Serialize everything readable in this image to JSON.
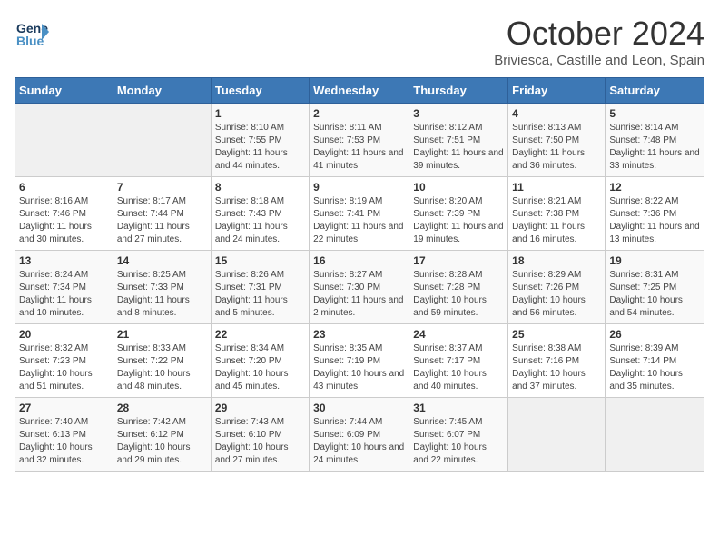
{
  "logo": {
    "general": "General",
    "blue": "Blue",
    "bird_icon": "▶"
  },
  "header": {
    "month": "October 2024",
    "location": "Briviesca, Castille and Leon, Spain"
  },
  "days_of_week": [
    "Sunday",
    "Monday",
    "Tuesday",
    "Wednesday",
    "Thursday",
    "Friday",
    "Saturday"
  ],
  "weeks": [
    [
      {
        "day": "",
        "info": ""
      },
      {
        "day": "",
        "info": ""
      },
      {
        "day": "1",
        "info": "Sunrise: 8:10 AM\nSunset: 7:55 PM\nDaylight: 11 hours and 44 minutes."
      },
      {
        "day": "2",
        "info": "Sunrise: 8:11 AM\nSunset: 7:53 PM\nDaylight: 11 hours and 41 minutes."
      },
      {
        "day": "3",
        "info": "Sunrise: 8:12 AM\nSunset: 7:51 PM\nDaylight: 11 hours and 39 minutes."
      },
      {
        "day": "4",
        "info": "Sunrise: 8:13 AM\nSunset: 7:50 PM\nDaylight: 11 hours and 36 minutes."
      },
      {
        "day": "5",
        "info": "Sunrise: 8:14 AM\nSunset: 7:48 PM\nDaylight: 11 hours and 33 minutes."
      }
    ],
    [
      {
        "day": "6",
        "info": "Sunrise: 8:16 AM\nSunset: 7:46 PM\nDaylight: 11 hours and 30 minutes."
      },
      {
        "day": "7",
        "info": "Sunrise: 8:17 AM\nSunset: 7:44 PM\nDaylight: 11 hours and 27 minutes."
      },
      {
        "day": "8",
        "info": "Sunrise: 8:18 AM\nSunset: 7:43 PM\nDaylight: 11 hours and 24 minutes."
      },
      {
        "day": "9",
        "info": "Sunrise: 8:19 AM\nSunset: 7:41 PM\nDaylight: 11 hours and 22 minutes."
      },
      {
        "day": "10",
        "info": "Sunrise: 8:20 AM\nSunset: 7:39 PM\nDaylight: 11 hours and 19 minutes."
      },
      {
        "day": "11",
        "info": "Sunrise: 8:21 AM\nSunset: 7:38 PM\nDaylight: 11 hours and 16 minutes."
      },
      {
        "day": "12",
        "info": "Sunrise: 8:22 AM\nSunset: 7:36 PM\nDaylight: 11 hours and 13 minutes."
      }
    ],
    [
      {
        "day": "13",
        "info": "Sunrise: 8:24 AM\nSunset: 7:34 PM\nDaylight: 11 hours and 10 minutes."
      },
      {
        "day": "14",
        "info": "Sunrise: 8:25 AM\nSunset: 7:33 PM\nDaylight: 11 hours and 8 minutes."
      },
      {
        "day": "15",
        "info": "Sunrise: 8:26 AM\nSunset: 7:31 PM\nDaylight: 11 hours and 5 minutes."
      },
      {
        "day": "16",
        "info": "Sunrise: 8:27 AM\nSunset: 7:30 PM\nDaylight: 11 hours and 2 minutes."
      },
      {
        "day": "17",
        "info": "Sunrise: 8:28 AM\nSunset: 7:28 PM\nDaylight: 10 hours and 59 minutes."
      },
      {
        "day": "18",
        "info": "Sunrise: 8:29 AM\nSunset: 7:26 PM\nDaylight: 10 hours and 56 minutes."
      },
      {
        "day": "19",
        "info": "Sunrise: 8:31 AM\nSunset: 7:25 PM\nDaylight: 10 hours and 54 minutes."
      }
    ],
    [
      {
        "day": "20",
        "info": "Sunrise: 8:32 AM\nSunset: 7:23 PM\nDaylight: 10 hours and 51 minutes."
      },
      {
        "day": "21",
        "info": "Sunrise: 8:33 AM\nSunset: 7:22 PM\nDaylight: 10 hours and 48 minutes."
      },
      {
        "day": "22",
        "info": "Sunrise: 8:34 AM\nSunset: 7:20 PM\nDaylight: 10 hours and 45 minutes."
      },
      {
        "day": "23",
        "info": "Sunrise: 8:35 AM\nSunset: 7:19 PM\nDaylight: 10 hours and 43 minutes."
      },
      {
        "day": "24",
        "info": "Sunrise: 8:37 AM\nSunset: 7:17 PM\nDaylight: 10 hours and 40 minutes."
      },
      {
        "day": "25",
        "info": "Sunrise: 8:38 AM\nSunset: 7:16 PM\nDaylight: 10 hours and 37 minutes."
      },
      {
        "day": "26",
        "info": "Sunrise: 8:39 AM\nSunset: 7:14 PM\nDaylight: 10 hours and 35 minutes."
      }
    ],
    [
      {
        "day": "27",
        "info": "Sunrise: 7:40 AM\nSunset: 6:13 PM\nDaylight: 10 hours and 32 minutes."
      },
      {
        "day": "28",
        "info": "Sunrise: 7:42 AM\nSunset: 6:12 PM\nDaylight: 10 hours and 29 minutes."
      },
      {
        "day": "29",
        "info": "Sunrise: 7:43 AM\nSunset: 6:10 PM\nDaylight: 10 hours and 27 minutes."
      },
      {
        "day": "30",
        "info": "Sunrise: 7:44 AM\nSunset: 6:09 PM\nDaylight: 10 hours and 24 minutes."
      },
      {
        "day": "31",
        "info": "Sunrise: 7:45 AM\nSunset: 6:07 PM\nDaylight: 10 hours and 22 minutes."
      },
      {
        "day": "",
        "info": ""
      },
      {
        "day": "",
        "info": ""
      }
    ]
  ]
}
